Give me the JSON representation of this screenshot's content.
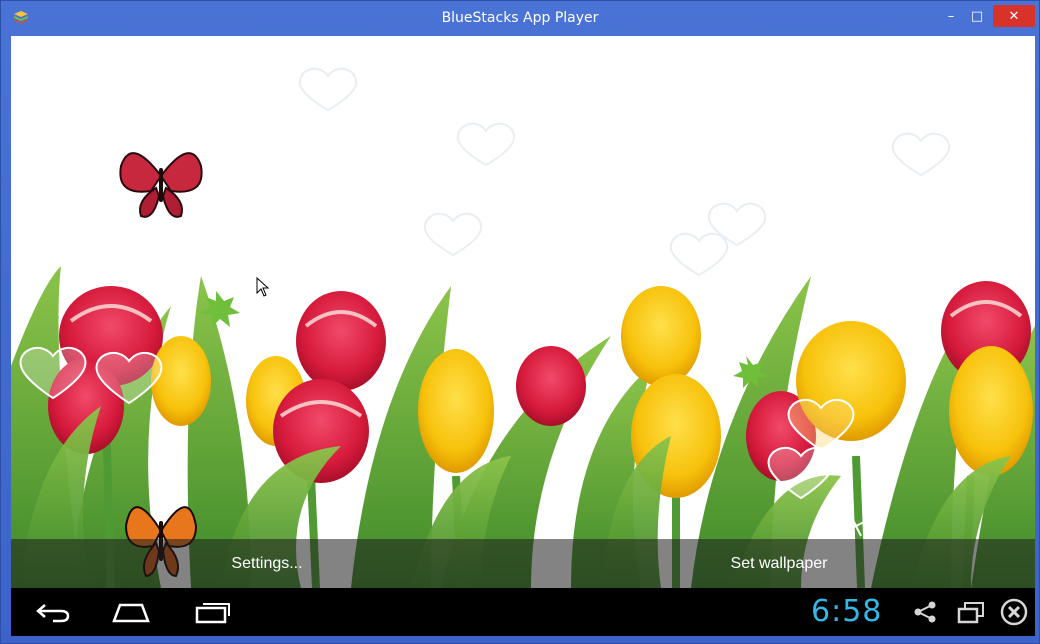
{
  "window": {
    "title": "BlueStacks App Player",
    "minimize_glyph": "–",
    "maximize_glyph": "□",
    "close_glyph": "✕"
  },
  "actions": {
    "settings_label": "Settings...",
    "set_wallpaper_label": "Set wallpaper"
  },
  "status": {
    "time": "6:58"
  },
  "icons": {
    "back": "back-arrow-icon",
    "home": "home-icon",
    "recents": "recent-apps-icon",
    "share": "share-icon",
    "window": "window-toggle-icon",
    "close": "close-circle-icon"
  },
  "colors": {
    "window_frame": "#3b63c9",
    "clock": "#35b6e5",
    "close_button": "#d8332b"
  }
}
